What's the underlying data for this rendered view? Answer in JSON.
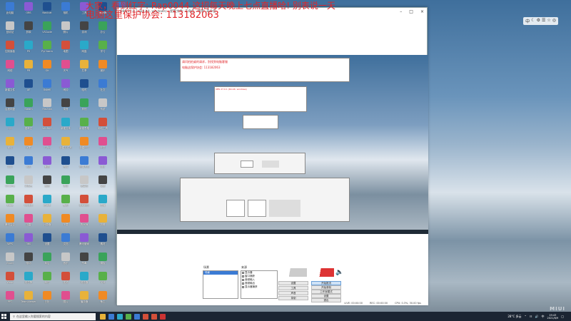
{
  "watermark": {
    "line1": "大家，看到红字: Rap0044 这招每天晚上七点直播哈! 别表说一天",
    "line2": "电脑这里保护协会: 113182063",
    "sub1": "请问拍拍桌的请求，别找到电脑客服",
    "sub2": "电脑这保护协会: 113182063"
  },
  "obs": {
    "title": "OBS 27.0.1 (64-bit, windows) - 配置文件: 未命名 - 场景: 未命名",
    "scenes_label": "场景",
    "scene_item": "场景",
    "sources_label": "来源",
    "sources": [
      "显示器",
      "窗口捕获",
      "音频输入",
      "音频输出",
      "显示器捕获"
    ],
    "buttons": [
      "开始推流",
      "开始录制",
      "工作室模式",
      "设置",
      "退出"
    ],
    "left_buttons": [
      "设置",
      "工具",
      "声音",
      "录制"
    ],
    "status": [
      "LIVE: 00:00:00",
      "REC: 00:00:00",
      "CPU: 0.3%, 30.00 fps"
    ]
  },
  "nested": {
    "title": "OBS 27.0.1 (64-bit, windows)"
  },
  "taskbar": {
    "search_placeholder": "在这里输入你要搜索的内容",
    "time": "19:43",
    "date": "2021/6/9",
    "weather": "28°C 多云"
  },
  "widget": {
    "items": [
      "中",
      "☾",
      "⚙",
      "☰",
      "☆",
      "◎"
    ]
  },
  "desktop_icons": [
    "此电脑",
    "回收站",
    "控制面板",
    "网络",
    "新建文件",
    "百度网盘",
    "QQ",
    "微信",
    "钉钉",
    "Chrome",
    "Edge",
    "腾讯会议",
    "WPS",
    "Excel",
    "Word",
    "PPT",
    "OBS",
    "剪映",
    "PS",
    "PR",
    "AE",
    "Steam",
    "爱奇艺",
    "优酷",
    "B站",
    "网易云",
    "QQ音乐",
    "迅雷",
    "360",
    "驱动",
    "向日葵",
    "TeamViewer",
    "Navicat",
    "VSCode",
    "PyCharm",
    "Git",
    "Xshell",
    "FileZilla",
    "WinRAR",
    "7-Zip",
    "截图",
    "画图",
    "记事本",
    "计算器",
    "设置",
    "商店",
    "邮件",
    "日历",
    "相机",
    "照片",
    "地图",
    "天气",
    "闹钟",
    "录音",
    "新建文本",
    "新建文件夹",
    "资料",
    "项目",
    "备份",
    "下载",
    "文档",
    "音乐",
    "视频",
    "图片",
    "工具",
    "游戏",
    "网盘",
    "共享",
    "临时",
    "其他",
    "新建表格",
    "新建PPT",
    "快捷方式",
    "安装包",
    "驱动精灵",
    "鲁大师",
    "腾讯管家",
    "杀毒",
    "浏览器",
    "播放器",
    "编辑器",
    "办公",
    "学习",
    "娱乐",
    "社交",
    "系统",
    "网络工具",
    "开发",
    "设计",
    "录屏",
    "直播",
    "剪辑",
    "素材",
    "模板",
    "字体",
    "备忘",
    "便签",
    "记账",
    "导航"
  ],
  "colors": {
    "accent": "#3b7bd4",
    "watermark": "#e0262a",
    "taskbar": "#1b2533"
  }
}
